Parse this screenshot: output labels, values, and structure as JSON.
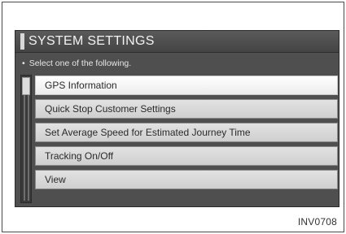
{
  "title": "SYSTEM SETTINGS",
  "instruction": {
    "bullet": "•",
    "text": "Select one of the following."
  },
  "menu": {
    "items": [
      {
        "label": "GPS Information",
        "selected": true
      },
      {
        "label": "Quick Stop Customer Settings",
        "selected": false
      },
      {
        "label": "Set Average Speed for Estimated Journey Time",
        "selected": false
      },
      {
        "label": "Tracking On/Off",
        "selected": false
      },
      {
        "label": "View",
        "selected": false
      }
    ]
  },
  "caption": "INV0708",
  "colors": {
    "screen_bg": "#4f4f4f",
    "item_bg": "#d8d8d8",
    "item_selected_bg": "#f5f5f5",
    "title_text": "#f2f2f2"
  }
}
